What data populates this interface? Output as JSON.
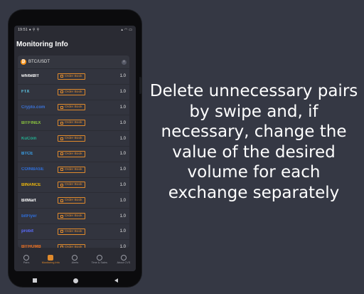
{
  "status_bar": {
    "time": "19:51",
    "left_icons": [
      "bitcoin-icon",
      "search-icon",
      "search-icon"
    ],
    "right_icons": [
      "signal-icon",
      "wifi-icon",
      "battery-icon"
    ]
  },
  "screen_title": "Monitoring Info",
  "pair": {
    "label": "BTC/USDT",
    "icon": "bitcoin-icon"
  },
  "order_book_label": "Order Book",
  "exchanges": [
    {
      "name": "whiteBIT",
      "color": "#ffffff",
      "volume": "1.0"
    },
    {
      "name": "FTX",
      "color": "#5fc9e8",
      "volume": "1.0"
    },
    {
      "name": "Crypto.com",
      "color": "#3b73d8",
      "volume": "1.0"
    },
    {
      "name": "BITFINEX",
      "color": "#8cc63f",
      "volume": "1.0"
    },
    {
      "name": "KuCoin",
      "color": "#23af91",
      "volume": "1.0"
    },
    {
      "name": "BTCE",
      "color": "#3aa4ee",
      "volume": "1.0"
    },
    {
      "name": "COINBASE",
      "color": "#2f6fdb",
      "volume": "1.0"
    },
    {
      "name": "BINANCE",
      "color": "#f0b90b",
      "volume": "1.0"
    },
    {
      "name": "BitMart",
      "color": "#ffffff",
      "volume": "1.0"
    },
    {
      "name": "bitFlyer",
      "color": "#2f6fdb",
      "volume": "1.0"
    },
    {
      "name": "probit",
      "color": "#5a6cff",
      "volume": "1.0"
    },
    {
      "name": "BITHUMB",
      "color": "#f37321",
      "volume": "1.0"
    }
  ],
  "bottom_nav": [
    {
      "label": "Pairs",
      "icon": "pairs-icon"
    },
    {
      "label": "Monitoring Info",
      "icon": "monitoring-icon",
      "active": true
    },
    {
      "label": "Alerts",
      "icon": "bell-icon"
    },
    {
      "label": "Time & Sales",
      "icon": "clock-icon"
    },
    {
      "label": "About CVS",
      "icon": "info-icon"
    }
  ],
  "caption_lines": [
    "Delete unnecessary pairs",
    "by swipe and, if",
    "necessary, change the",
    "value of the desired",
    "volume for each",
    "exchange separately"
  ],
  "colors": {
    "background": "#353844",
    "accent": "#e08a2c",
    "screen": "#2a2b33",
    "card": "#32343e"
  }
}
